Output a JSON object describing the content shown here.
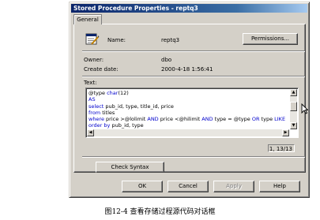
{
  "window": {
    "title": "Stored Procedure Properties - reptq3",
    "tab": "General"
  },
  "icons": {
    "procedure": "stored-procedure-icon",
    "scroll_up": "scroll-up-arrow-icon",
    "scroll_down": "scroll-down-arrow-icon",
    "scroll_left": "scroll-left-arrow-icon",
    "scroll_right": "scroll-right-arrow-icon",
    "cursor": "mouse-pointer-icon"
  },
  "fields": {
    "name_label": "Name:",
    "name_value": "reptq3",
    "owner_label": "Owner:",
    "owner_value": "dbo",
    "created_label": "Create date:",
    "created_value": "2000-4-18 1:56:41",
    "text_label": "Text:"
  },
  "code_lines": [
    [
      {
        "t": "@type ",
        "c": "n"
      },
      {
        "t": "char",
        "c": "k"
      },
      {
        "t": "(12)",
        "c": "n"
      }
    ],
    [
      {
        "t": "AS",
        "c": "k"
      }
    ],
    [
      {
        "t": "select",
        "c": "k"
      },
      {
        "t": " pub_id, type, title_id, price",
        "c": "n"
      }
    ],
    [
      {
        "t": "from",
        "c": "k"
      },
      {
        "t": " titles",
        "c": "n"
      }
    ],
    [
      {
        "t": "where",
        "c": "k"
      },
      {
        "t": " price >@lolimit ",
        "c": "n"
      },
      {
        "t": "AND",
        "c": "k"
      },
      {
        "t": " price <@hilimit ",
        "c": "n"
      },
      {
        "t": "AND",
        "c": "k"
      },
      {
        "t": " type = @type ",
        "c": "n"
      },
      {
        "t": "OR",
        "c": "k"
      },
      {
        "t": " type ",
        "c": "n"
      },
      {
        "t": "LIKE",
        "c": "k"
      },
      {
        "t": " '%cook",
        "c": "s"
      }
    ],
    [
      {
        "t": "order",
        "c": "k"
      },
      {
        "t": " ",
        "c": "n"
      },
      {
        "t": "by",
        "c": "k"
      },
      {
        "t": " pub_id, type",
        "c": "n"
      }
    ]
  ],
  "position": "1, 13/13",
  "buttons": {
    "permissions": "Permissions...",
    "check_syntax": "Check Syntax",
    "ok": "OK",
    "cancel": "Cancel",
    "apply": "Apply",
    "help": "Help"
  },
  "colors": {
    "keyword": "#0000cc",
    "string": "#cc0000",
    "titlebar": "#0a246a",
    "dialog": "#d4d0c8"
  },
  "caption": "图12-4  查看存储过程源代码对话框"
}
